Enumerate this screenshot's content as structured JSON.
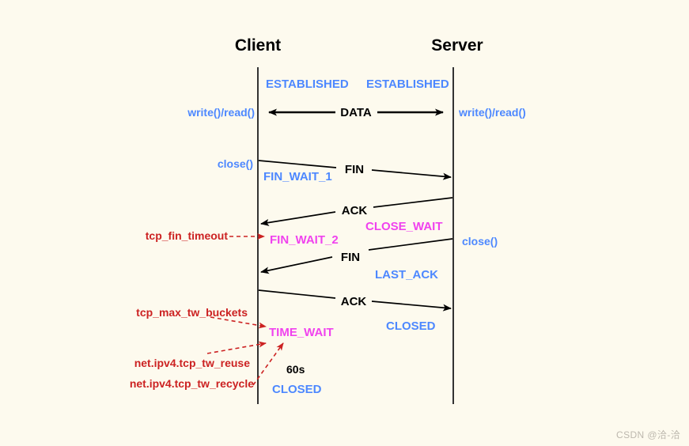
{
  "diagram": {
    "title": "TCP connection close sequence diagram",
    "background_color": "#fdfaee",
    "colors": {
      "state_blue": "#4d88ff",
      "state_magenta": "#f042ee",
      "sysctl_red": "#cc2222",
      "message_black": "#000000",
      "lifeline": "#333333",
      "watermark": "#bdb8ae"
    },
    "actors": {
      "client": "Client",
      "server": "Server"
    },
    "states_client": [
      {
        "label": "ESTABLISHED",
        "color": "blue"
      },
      {
        "label": "FIN_WAIT_1",
        "color": "blue"
      },
      {
        "label": "FIN_WAIT_2",
        "color": "magenta"
      },
      {
        "label": "TIME_WAIT",
        "color": "magenta"
      },
      {
        "label": "CLOSED",
        "color": "blue"
      }
    ],
    "states_server": [
      {
        "label": "ESTABLISHED",
        "color": "blue"
      },
      {
        "label": "CLOSE_WAIT",
        "color": "magenta"
      },
      {
        "label": "LAST_ACK",
        "color": "blue"
      },
      {
        "label": "CLOSED",
        "color": "blue"
      }
    ],
    "api_calls": [
      {
        "label": "write()/read()",
        "side": "client"
      },
      {
        "label": "write()/read()",
        "side": "server"
      },
      {
        "label": "close()",
        "side": "client"
      },
      {
        "label": "close()",
        "side": "server"
      }
    ],
    "messages": [
      {
        "label": "DATA",
        "direction": "bidirectional"
      },
      {
        "label": "FIN",
        "direction": "client-to-server"
      },
      {
        "label": "ACK",
        "direction": "server-to-client"
      },
      {
        "label": "FIN",
        "direction": "server-to-client"
      },
      {
        "label": "ACK",
        "direction": "client-to-server"
      }
    ],
    "timer": "60s",
    "sysctl_annotations": [
      {
        "label": "tcp_fin_timeout",
        "target": "FIN_WAIT_2"
      },
      {
        "label": "tcp_max_tw_buckets",
        "target": "TIME_WAIT"
      },
      {
        "label": "net.ipv4.tcp_tw_reuse",
        "target": "TIME_WAIT"
      },
      {
        "label": "net.ipv4.tcp_tw_recycle",
        "target": "TIME_WAIT"
      }
    ],
    "watermark": "CSDN @洽-洽"
  }
}
